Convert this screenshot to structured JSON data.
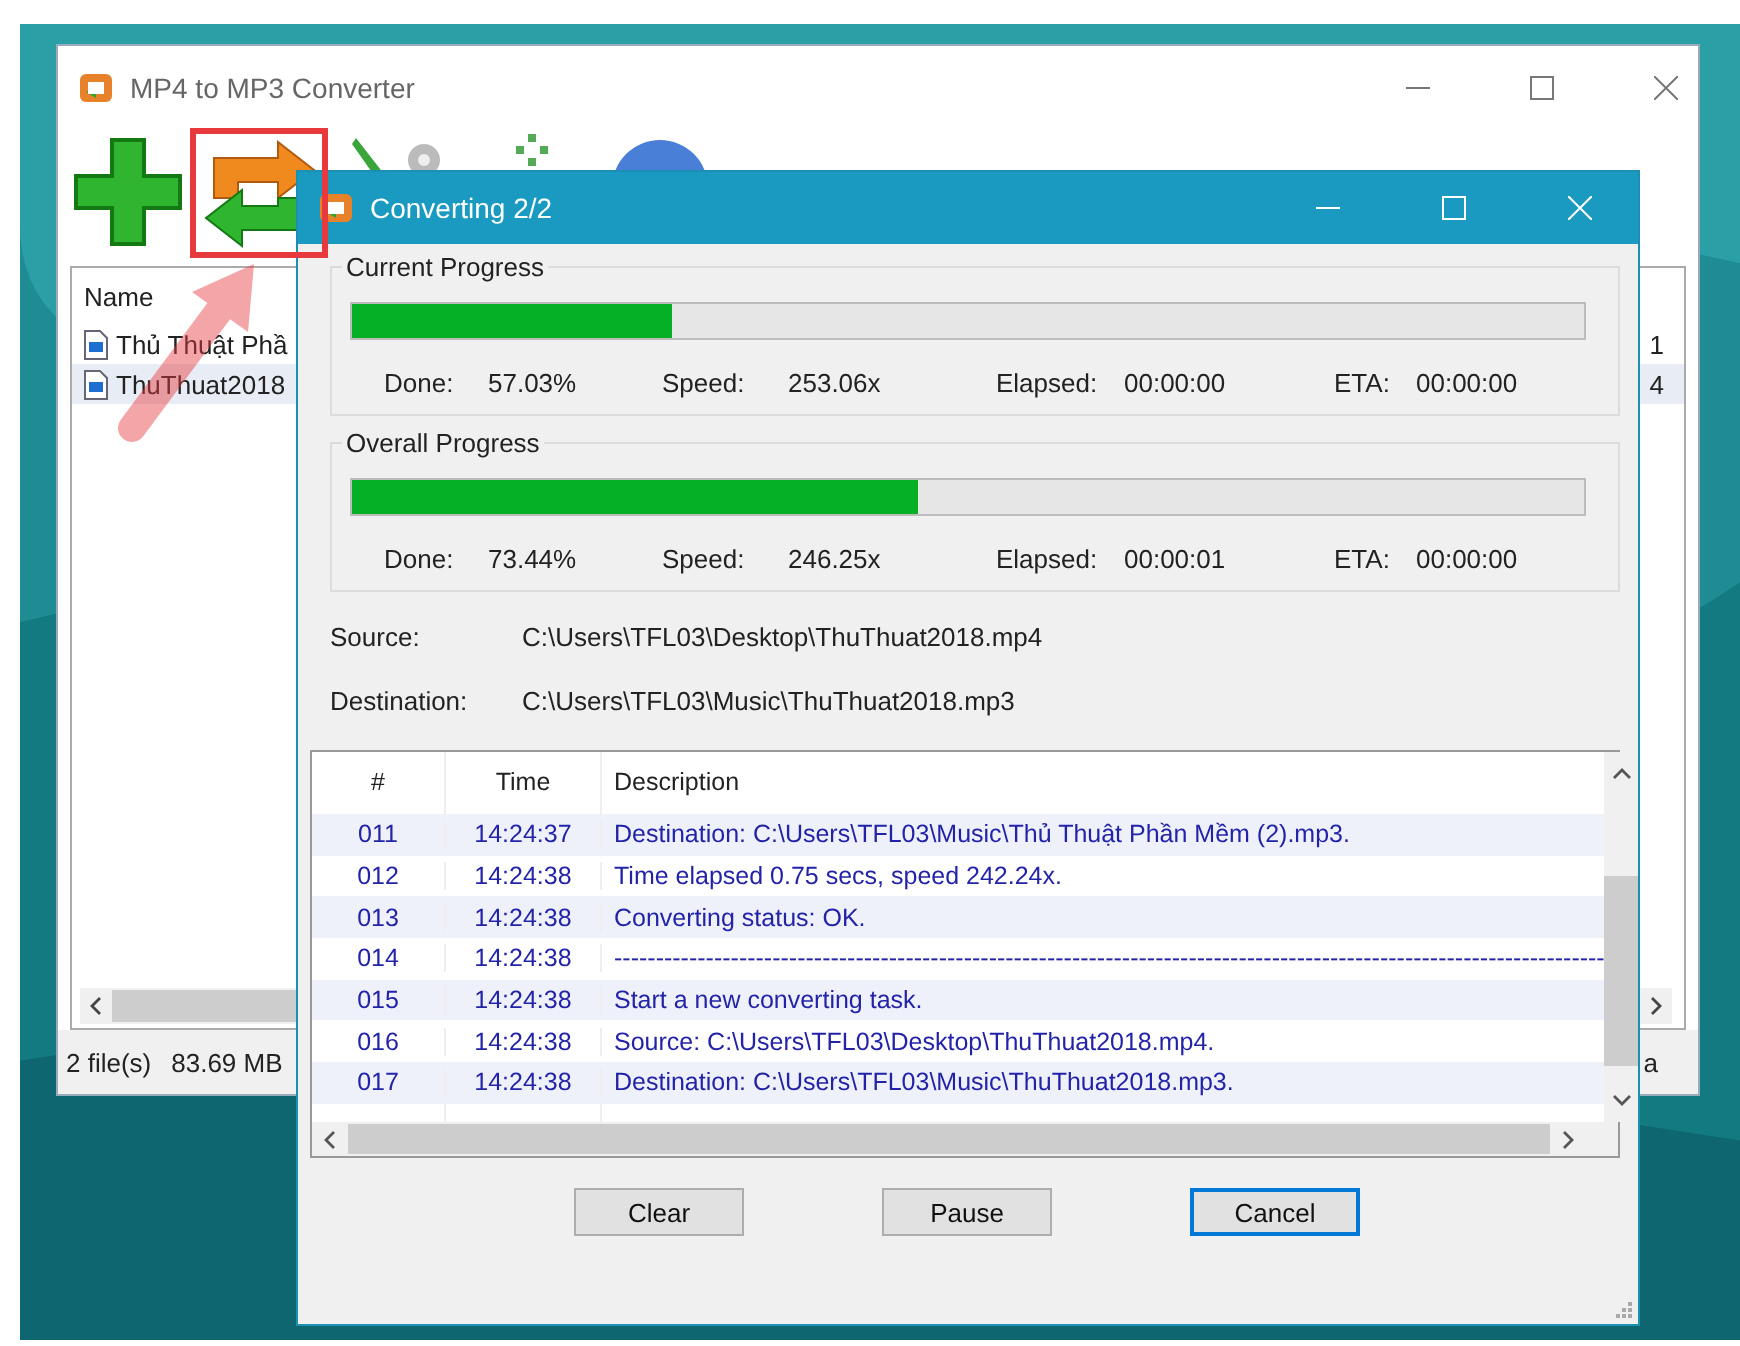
{
  "main_window": {
    "title": "MP4 to MP3 Converter",
    "file_list": {
      "columns": [
        "Name"
      ],
      "rows": [
        {
          "name": "Thủ Thuật Phầ",
          "column_2": "1",
          "selected": false
        },
        {
          "name": "ThuThuat2018",
          "column_2": "4",
          "selected": true
        }
      ]
    },
    "status_bar": [
      "2 file(s)",
      "83.69 MB",
      "a"
    ]
  },
  "dialog": {
    "title": "Converting 2/2",
    "groups": [
      {
        "title": "Current Progress",
        "level": 0.26,
        "stats": [
          {
            "label": "Done:",
            "value": "57.03%"
          },
          {
            "label": "Speed:",
            "value": "253.06x"
          },
          {
            "label": "Elapsed:",
            "value": "00:00:00"
          },
          {
            "label": "ETA:",
            "value": "00:00:00"
          }
        ]
      },
      {
        "title": "Overall Progress",
        "level": 0.46,
        "stats": [
          {
            "label": "Done:",
            "value": "73.44%"
          },
          {
            "label": "Speed:",
            "value": "246.25x"
          },
          {
            "label": "Elapsed:",
            "value": "00:00:01"
          },
          {
            "label": "ETA:",
            "value": "00:00:00"
          }
        ]
      }
    ],
    "paths": [
      {
        "label": "Source:",
        "value": "C:\\Users\\TFL03\\Desktop\\ThuThuat2018.mp4"
      },
      {
        "label": "Destination:",
        "value": "C:\\Users\\TFL03\\Music\\ThuThuat2018.mp3"
      }
    ],
    "log": {
      "columns": [
        "#",
        "Time",
        "Description"
      ],
      "rows": [
        {
          "num": "011",
          "time": "14:24:37",
          "description": "Destination: C:\\Users\\TFL03\\Music\\Thủ Thuật Phần Mềm (2).mp3."
        },
        {
          "num": "012",
          "time": "14:24:38",
          "description": "Time elapsed 0.75 secs, speed 242.24x."
        },
        {
          "num": "013",
          "time": "14:24:38",
          "description": "Converting status: OK."
        },
        {
          "num": "014",
          "time": "14:24:38",
          "description": "-----------------------------------------------------------------------------------------------------------------------"
        },
        {
          "num": "015",
          "time": "14:24:38",
          "description": "Start a new converting task."
        },
        {
          "num": "016",
          "time": "14:24:38",
          "description": "Source:  C:\\Users\\TFL03\\Desktop\\ThuThuat2018.mp4."
        },
        {
          "num": "017",
          "time": "14:24:38",
          "description": "Destination: C:\\Users\\TFL03\\Music\\ThuThuat2018.mp3."
        }
      ]
    },
    "buttons": [
      {
        "label": "Clear",
        "default": false
      },
      {
        "label": "Pause",
        "default": false
      },
      {
        "label": "Cancel",
        "default": true
      }
    ]
  }
}
